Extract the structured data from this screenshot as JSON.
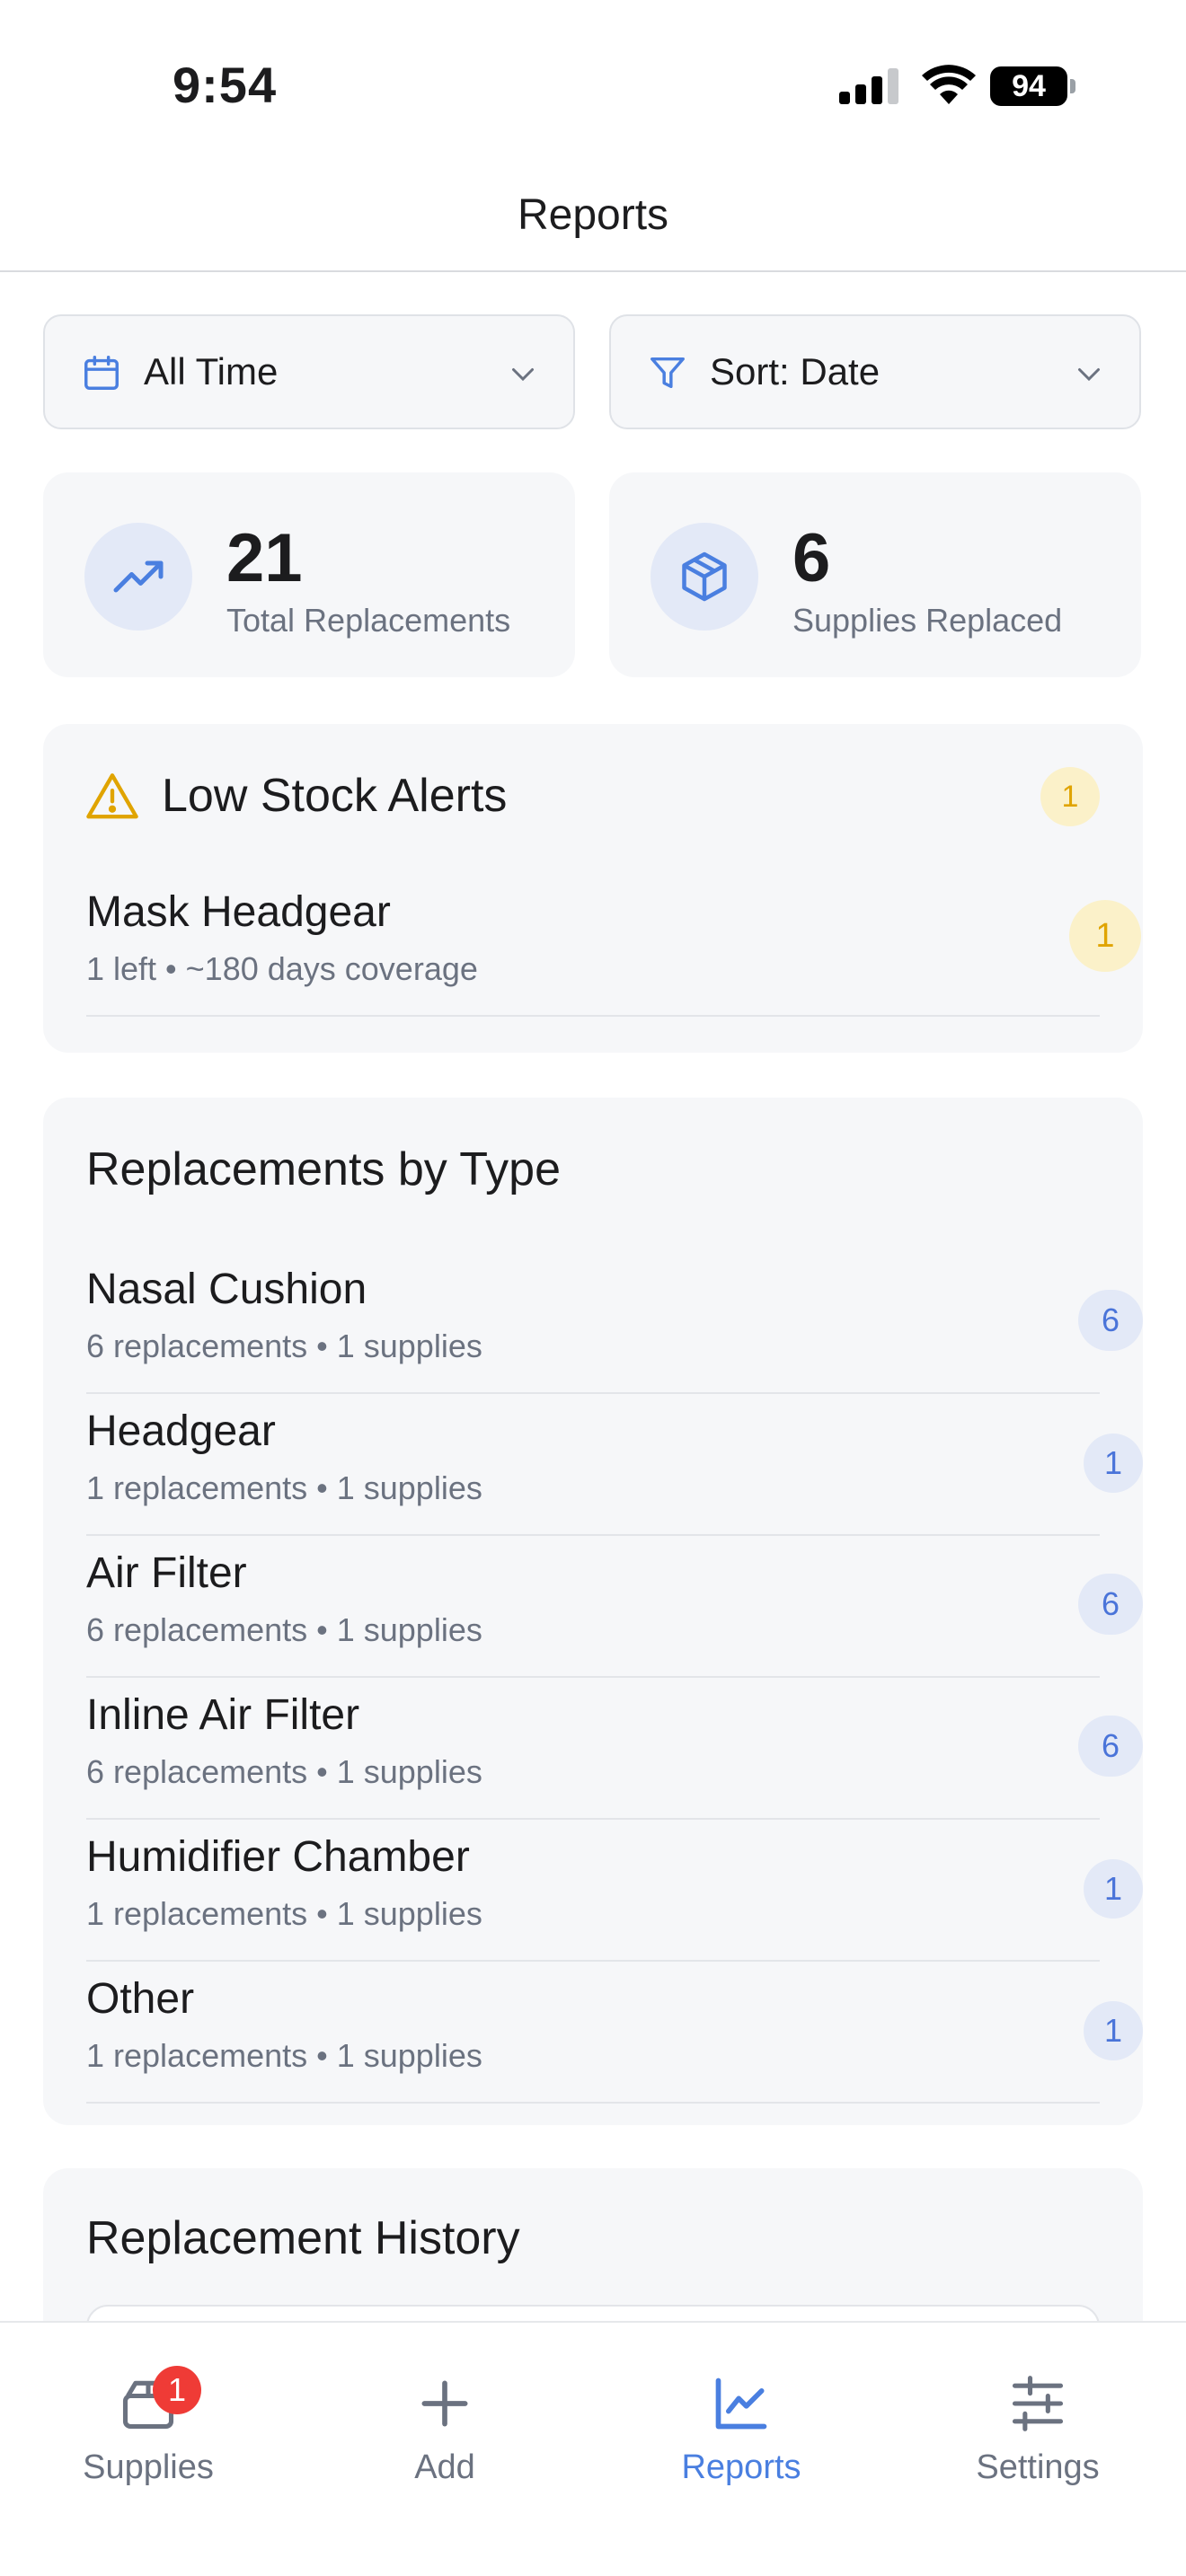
{
  "status_bar": {
    "time": "9:54",
    "battery": "94"
  },
  "header": {
    "title": "Reports"
  },
  "filters": {
    "range_label": "All Time",
    "sort_label": "Sort: Date"
  },
  "stats": [
    {
      "value": "21",
      "label": "Total Replacements"
    },
    {
      "value": "6",
      "label": "Supplies Replaced"
    }
  ],
  "low_stock": {
    "title": "Low Stock Alerts",
    "count": "1",
    "items": [
      {
        "name": "Mask Headgear",
        "meta": "1 left • ~180 days coverage",
        "badge": "1"
      }
    ]
  },
  "by_type": {
    "title": "Replacements by Type",
    "items": [
      {
        "name": "Nasal Cushion",
        "meta": "6 replacements • 1 supplies",
        "badge": "6"
      },
      {
        "name": "Headgear",
        "meta": "1 replacements • 1 supplies",
        "badge": "1"
      },
      {
        "name": "Air Filter",
        "meta": "6 replacements • 1 supplies",
        "badge": "6"
      },
      {
        "name": "Inline Air Filter",
        "meta": "6 replacements • 1 supplies",
        "badge": "6"
      },
      {
        "name": "Humidifier Chamber",
        "meta": "1 replacements • 1 supplies",
        "badge": "1"
      },
      {
        "name": "Other",
        "meta": "1 replacements • 1 supplies",
        "badge": "1"
      }
    ]
  },
  "history": {
    "title": "Replacement History"
  },
  "tabbar": {
    "supplies_badge": "1",
    "tabs": [
      {
        "label": "Supplies",
        "icon": "box-icon"
      },
      {
        "label": "Add",
        "icon": "plus-icon"
      },
      {
        "label": "Reports",
        "icon": "chart-icon",
        "active": true
      },
      {
        "label": "Settings",
        "icon": "sliders-icon"
      }
    ]
  },
  "colors": {
    "accent": "#4a7fe0",
    "warning": "#e0a400",
    "badge_red": "#ef3b36",
    "card_bg": "#f6f7f9"
  }
}
